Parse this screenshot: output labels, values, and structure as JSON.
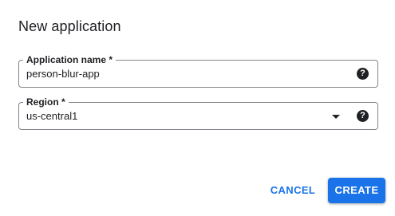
{
  "dialog": {
    "title": "New application"
  },
  "fields": {
    "application_name": {
      "label": "Application name *",
      "value": "person-blur-app",
      "help_icon": "help-circle-icon"
    },
    "region": {
      "label": "Region *",
      "value": "us-central1",
      "dropdown_icon": "dropdown-arrow-icon",
      "help_icon": "help-circle-icon"
    }
  },
  "actions": {
    "cancel_label": "CANCEL",
    "create_label": "CREATE"
  },
  "colors": {
    "accent": "#1a73e8",
    "text": "#202124",
    "border": "#80868b",
    "background": "#ffffff"
  }
}
